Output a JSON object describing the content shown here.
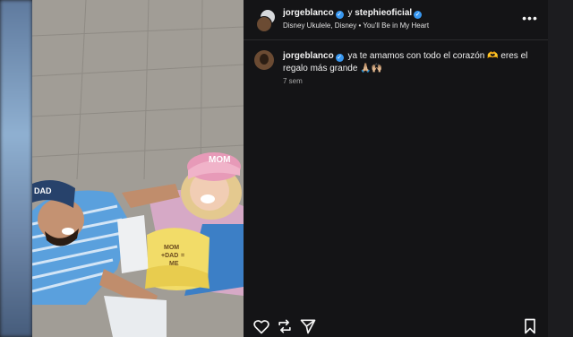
{
  "post": {
    "author": "jorgeblanco",
    "connector": "y",
    "collaborator": "stephieoficial",
    "audio": "Disney Ukulele, Disney • You'll Be in My Heart"
  },
  "comment": {
    "author": "jorgeblanco",
    "text": "ya te amamos con todo el corazón 🫶 eres el regalo más grande 🙏🏼🙌🏼",
    "time": "7 sem"
  },
  "photo": {
    "cap_left_text": "DAD",
    "cap_right_text": "MOM",
    "cap_center_line1": "MOM",
    "cap_center_line2": "+DAD",
    "cap_center_line3": "=",
    "cap_center_line4": "ME"
  },
  "icons": {
    "more": "more-options-icon",
    "heart": "heart-icon",
    "comment": "comment-icon",
    "share": "share-icon",
    "bookmark": "bookmark-icon"
  },
  "colors": {
    "panel": "#141416",
    "verified": "#3897f0",
    "text": "#f5f5f5"
  }
}
